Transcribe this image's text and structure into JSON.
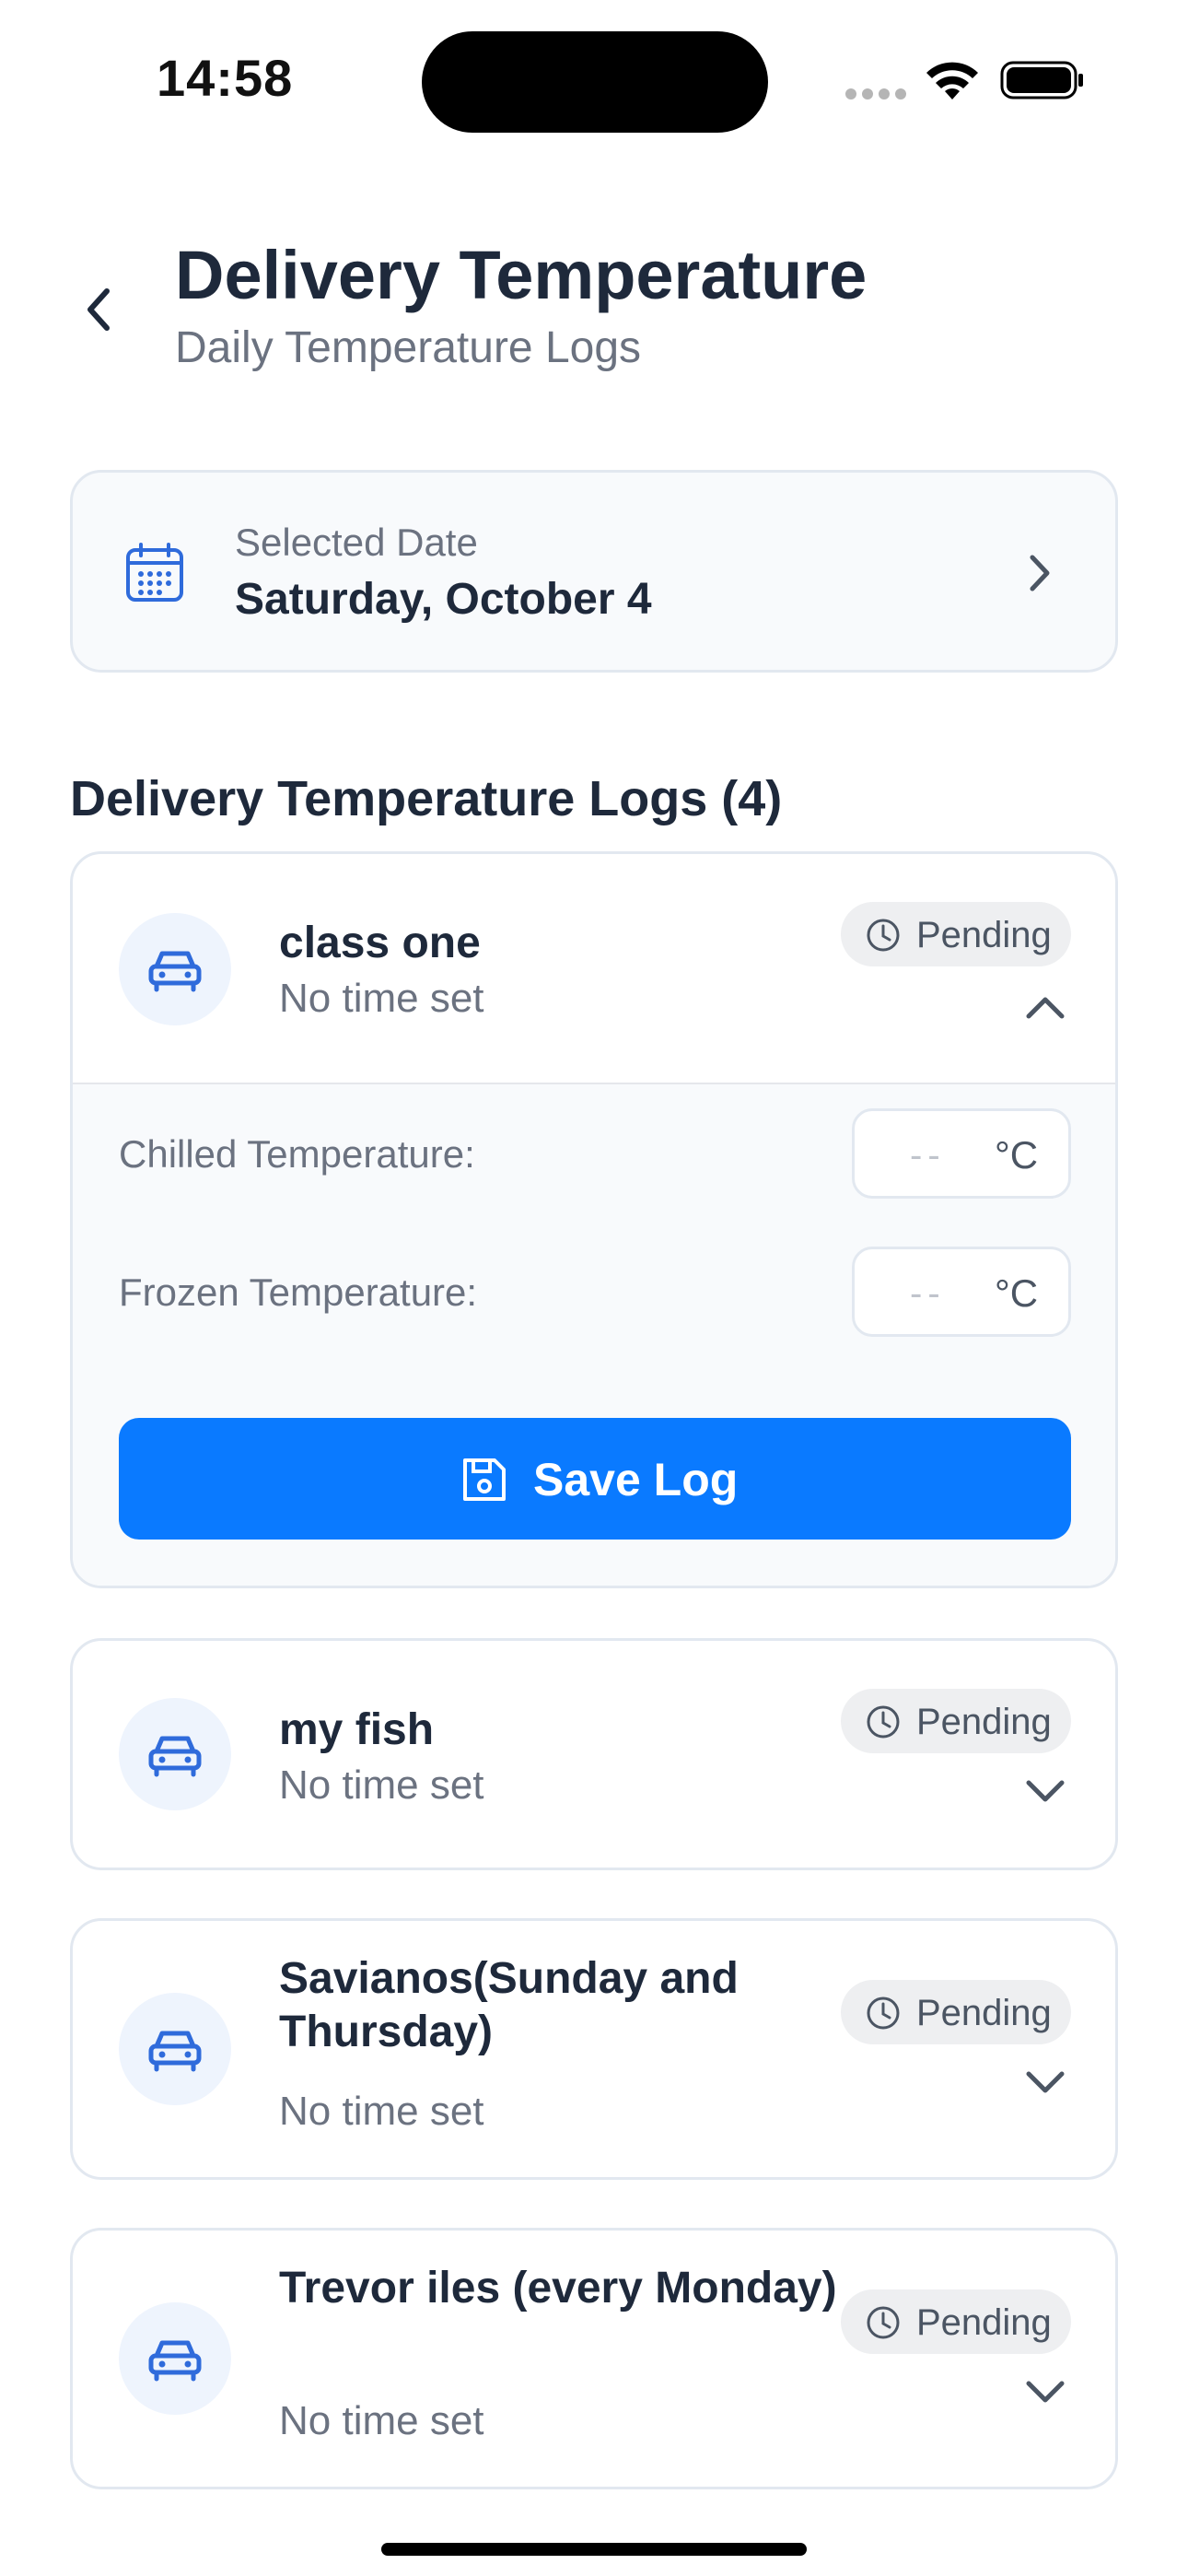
{
  "status_bar": {
    "time": "14:58"
  },
  "header": {
    "title": "Delivery Temperature",
    "subtitle": "Daily Temperature Logs",
    "back_icon": "chevron-left-icon"
  },
  "date_selector": {
    "label": "Selected Date",
    "value": "Saturday, October 4",
    "icon": "calendar-icon"
  },
  "logs_section": {
    "title": "Delivery Temperature Logs (4)",
    "items": [
      {
        "name": "class one",
        "time": "No time set",
        "status": "Pending",
        "expanded": true,
        "chilled_label": "Chilled Temperature:",
        "chilled_placeholder": "--",
        "frozen_label": "Frozen Temperature:",
        "frozen_placeholder": "--",
        "unit": "°C",
        "save_label": "Save Log"
      },
      {
        "name": "my fish",
        "time": "No time set",
        "status": "Pending",
        "expanded": false
      },
      {
        "name": "Savianos(Sunday and Thursday)",
        "time": "No time set",
        "status": "Pending",
        "expanded": false
      },
      {
        "name": "Trevor iles (every Monday)",
        "time": "No time set",
        "status": "Pending",
        "expanded": false
      }
    ]
  },
  "colors": {
    "accent": "#0a7aff",
    "icon_blue": "#2f6bdb",
    "badge_bg": "#eeeff1",
    "card_border": "#e2e8f0"
  }
}
